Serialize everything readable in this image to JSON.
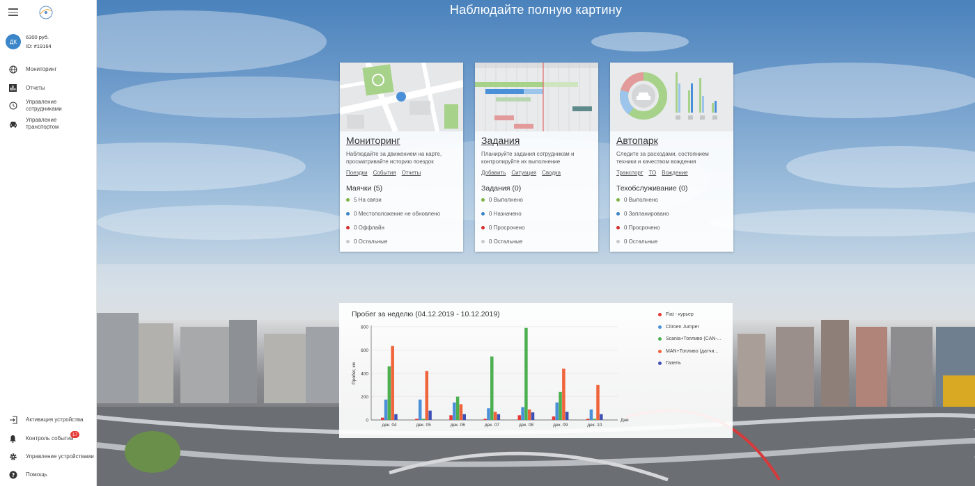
{
  "sidebar": {
    "avatar": "ДК",
    "balance": "6300 руб.",
    "user_id": "ID: #19164",
    "top_items": [
      {
        "label": "Мониторинг",
        "icon": "globe-icon"
      },
      {
        "label": "Отчеты",
        "icon": "bar-chart-icon"
      },
      {
        "label": "Управление сотрудниками",
        "icon": "clock-icon"
      },
      {
        "label": "Управление транспортом",
        "icon": "car-icon"
      }
    ],
    "bottom_items": [
      {
        "label": "Активация устройства",
        "icon": "login-icon"
      },
      {
        "label": "Контроль событий",
        "icon": "bell-icon"
      },
      {
        "label": "Управление устройствами",
        "icon": "gear-icon"
      },
      {
        "label": "Помощь",
        "icon": "help-icon"
      }
    ],
    "events_badge": "17"
  },
  "headline": "Наблюдайте полную картину",
  "cards": [
    {
      "title": "Мониторинг",
      "description": "Наблюдайте за движением на карте, просматривайте историю поездок",
      "links": [
        "Поездки",
        "События",
        "Отчеты"
      ],
      "section": "Маячки (5)",
      "statuses": [
        {
          "label": "5 На связи",
          "color": "#7cb342"
        },
        {
          "label": "0 Местоположение не обновлено",
          "color": "#3a86c8"
        },
        {
          "label": "0 Оффлайн",
          "color": "#d32f2f"
        },
        {
          "label": "0 Остальные",
          "color": "#c8c8c8"
        }
      ]
    },
    {
      "title": "Задания",
      "description": "Планируйте задания сотрудникам и контролируйте их выполнение",
      "links": [
        "Добавить",
        "Ситуация",
        "Сводка"
      ],
      "section": "Задания (0)",
      "statuses": [
        {
          "label": "0 Выполнено",
          "color": "#7cb342"
        },
        {
          "label": "0 Назначено",
          "color": "#3a86c8"
        },
        {
          "label": "0 Просрочено",
          "color": "#d32f2f"
        },
        {
          "label": "0 Остальные",
          "color": "#c8c8c8"
        }
      ]
    },
    {
      "title": "Автопарк",
      "description": "Следите за расходами, состоянием техники и качеством вождения",
      "links": [
        "Транспорт",
        "ТО",
        "Вождение"
      ],
      "section": "Техобслуживание (0)",
      "statuses": [
        {
          "label": "0 Выполнено",
          "color": "#7cb342"
        },
        {
          "label": "0 Запланировано",
          "color": "#3a86c8"
        },
        {
          "label": "0 Просрочено",
          "color": "#d32f2f"
        },
        {
          "label": "0 Остальные",
          "color": "#c8c8c8"
        }
      ]
    }
  ],
  "chart_data": {
    "type": "bar",
    "title": "Пробег за неделю (04.12.2019 - 10.12.2019)",
    "xlabel": "Дни",
    "ylabel": "Пробег, км",
    "ylim": [
      0,
      800
    ],
    "yticks": [
      0,
      200,
      400,
      600,
      800
    ],
    "categories": [
      "дек. 04",
      "дек. 05",
      "дек. 06",
      "дек. 07",
      "дек. 08",
      "дек. 09",
      "дек. 10"
    ],
    "grid": true,
    "legend_position": "right",
    "series": [
      {
        "name": "Fiat - курьер",
        "color": "#e53935",
        "values": [
          20,
          10,
          40,
          10,
          40,
          30,
          10
        ]
      },
      {
        "name": "Citroen Jumper",
        "color": "#4a90d9",
        "values": [
          175,
          175,
          150,
          100,
          110,
          150,
          90
        ]
      },
      {
        "name": "Scania+Топливо (CAN-...",
        "color": "#4caf50",
        "values": [
          460,
          10,
          200,
          545,
          790,
          240,
          10
        ]
      },
      {
        "name": "MAN+Топливо (датчи...",
        "color": "#f0643c",
        "values": [
          635,
          420,
          135,
          70,
          90,
          440,
          300
        ]
      },
      {
        "name": "Газель",
        "color": "#3f51b5",
        "values": [
          50,
          80,
          50,
          50,
          65,
          70,
          50
        ]
      }
    ]
  }
}
